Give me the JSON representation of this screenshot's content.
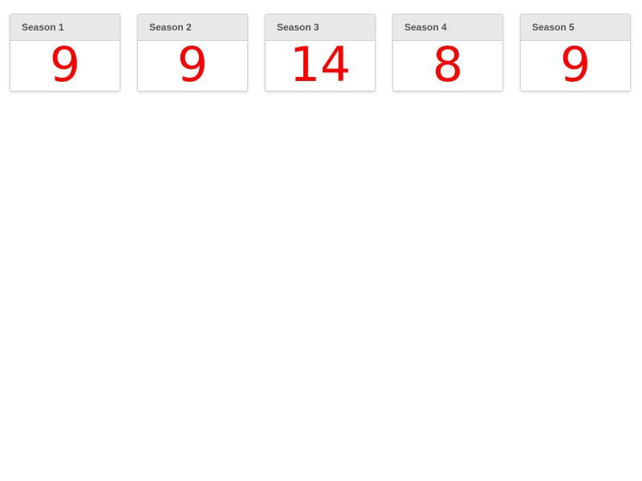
{
  "colors": {
    "value": "#ff0000",
    "header_bg": "#e8e8e8",
    "header_text": "#555555"
  },
  "cards": [
    {
      "title": "Season 1",
      "value": "9"
    },
    {
      "title": "Season 2",
      "value": "9"
    },
    {
      "title": "Season 3",
      "value": "14"
    },
    {
      "title": "Season 4",
      "value": "8"
    },
    {
      "title": "Season 5",
      "value": "9"
    }
  ]
}
